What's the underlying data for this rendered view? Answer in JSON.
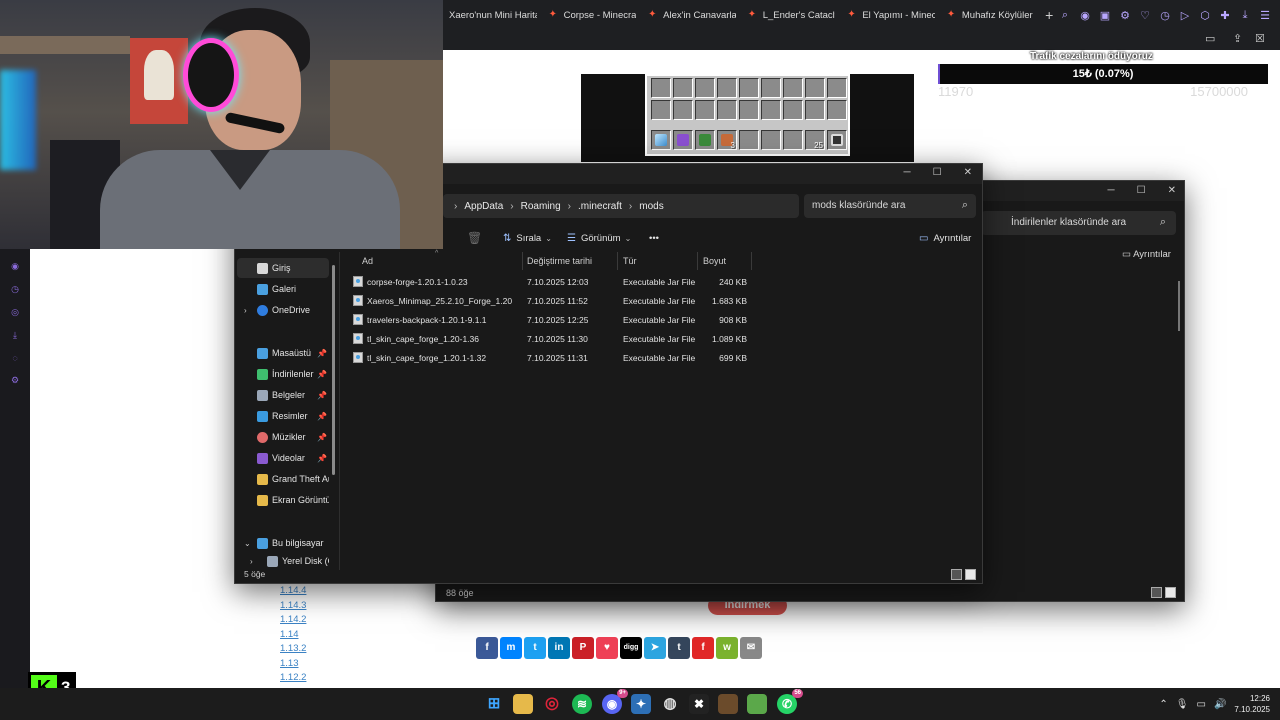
{
  "browser": {
    "tabs": [
      "Xaero'nun Mini Haritası",
      "Corpse - Minecraft Mod",
      "Alex'in Canavarları - Mi",
      "L_Ender's Cataclysm - M",
      "El Yapımı - Minecraft Mo",
      "Muhafız Köylüler - Mine"
    ],
    "new_tab": "+"
  },
  "donation": {
    "title": "Trafik cezalarını ödüyoruz",
    "amount": "15₺ (0.07%)",
    "progress_percent": 0.07,
    "min": "11970",
    "max": "15700000"
  },
  "inventory": {
    "counts": {
      "ginger": "3",
      "stack": "25"
    }
  },
  "explorer_back": {
    "search_placeholder": "İndirilenler klasöründe ara",
    "details": "Ayrıntılar",
    "status": "88 öğe"
  },
  "explorer_front": {
    "breadcrumb": [
      "AppData",
      "Roaming",
      ".minecraft",
      "mods"
    ],
    "search_placeholder": "mods klasöründe ara",
    "toolbar": {
      "sort": "Sırala",
      "view": "Görünüm",
      "more": "•••",
      "details": "Ayrıntılar"
    },
    "sidebar": [
      "Giriş",
      "Galeri",
      "OneDrive",
      "Masaüstü",
      "İndirilenler",
      "Belgeler",
      "Resimler",
      "Müzikler",
      "Videolar",
      "Grand Theft Aut",
      "Ekran Görüntüle",
      "Bu bilgisayar",
      "Yerel Disk (C:)"
    ],
    "columns": [
      "Ad",
      "Değiştirme tarihi",
      "Tür",
      "Boyut"
    ],
    "files": [
      {
        "name": "corpse-forge-1.20.1-1.0.23",
        "date": "7.10.2025 12:03",
        "type": "Executable Jar File",
        "size": "240 KB"
      },
      {
        "name": "Xaeros_Minimap_25.2.10_Forge_1.20",
        "date": "7.10.2025 11:52",
        "type": "Executable Jar File",
        "size": "1.683 KB"
      },
      {
        "name": "travelers-backpack-1.20.1-9.1.1",
        "date": "7.10.2025 12:25",
        "type": "Executable Jar File",
        "size": "908 KB"
      },
      {
        "name": "tl_skin_cape_forge_1.20-1.36",
        "date": "7.10.2025 11:30",
        "type": "Executable Jar File",
        "size": "1.089 KB"
      },
      {
        "name": "tl_skin_cape_forge_1.20.1-1.32",
        "date": "7.10.2025 11:31",
        "type": "Executable Jar File",
        "size": "699 KB"
      }
    ],
    "status": "5 öğe"
  },
  "webpage": {
    "versions": [
      "1.14.4",
      "1.14.3",
      "1.14.2",
      "1.14",
      "1.13.2",
      "1.13",
      "1.12.2"
    ],
    "download_button": "İndirmek",
    "share_icons": [
      "facebook-icon",
      "messenger-icon",
      "twitter-icon",
      "linkedin-icon",
      "pinterest-icon",
      "pocket-icon",
      "digg-icon",
      "telegram-icon",
      "tumblr-icon",
      "flipboard-icon",
      "wechat-icon",
      "email-icon"
    ],
    "share_labels": [
      "f",
      "m",
      "t",
      "in",
      "P",
      "♥",
      "digg",
      "➤",
      "t",
      "f",
      "w",
      "✉"
    ],
    "share_colors": [
      "#3b5998",
      "#0084ff",
      "#1da1f2",
      "#0077b5",
      "#cb2027",
      "#ef4056",
      "#000000",
      "#2ca5e0",
      "#35465c",
      "#e12828",
      "#7bb32e",
      "#888888"
    ]
  },
  "kick": {
    "letter": "K",
    "number": "3"
  },
  "taskbar": {
    "whatsapp_badge": "56",
    "discord_badge": "9+",
    "time": "12:26",
    "date": "7.10.2025"
  }
}
